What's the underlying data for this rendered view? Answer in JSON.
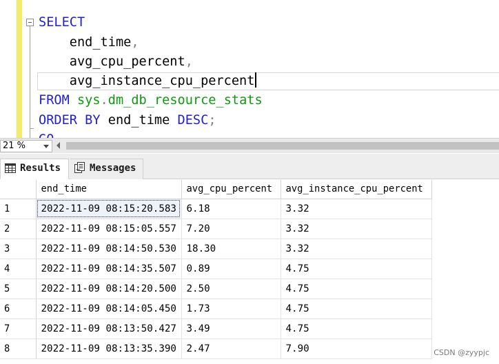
{
  "editor": {
    "lines": {
      "select": "SELECT",
      "col1": "end_time",
      "col2": "avg_cpu_percent",
      "col3": "avg_instance_cpu_percent",
      "from_kw": "FROM",
      "from_schema": "sys",
      "from_obj": "dm_db_resource_stats",
      "order_kw": "ORDER BY",
      "order_col": "end_time",
      "order_dir": "DESC",
      "go_partial": "GO"
    }
  },
  "status": {
    "zoom": "21 %"
  },
  "tabs": {
    "results_label": "Results",
    "messages_label": "Messages"
  },
  "grid": {
    "columns": [
      "end_time",
      "avg_cpu_percent",
      "avg_instance_cpu_percent"
    ],
    "rows": [
      {
        "n": "1",
        "end_time": "2022-11-09 08:15:20.583",
        "avg_cpu_percent": "6.18",
        "avg_instance_cpu_percent": "3.32"
      },
      {
        "n": "2",
        "end_time": "2022-11-09 08:15:05.557",
        "avg_cpu_percent": "7.20",
        "avg_instance_cpu_percent": "3.32"
      },
      {
        "n": "3",
        "end_time": "2022-11-09 08:14:50.530",
        "avg_cpu_percent": "18.30",
        "avg_instance_cpu_percent": "3.32"
      },
      {
        "n": "4",
        "end_time": "2022-11-09 08:14:35.507",
        "avg_cpu_percent": "0.89",
        "avg_instance_cpu_percent": "4.75"
      },
      {
        "n": "5",
        "end_time": "2022-11-09 08:14:20.500",
        "avg_cpu_percent": "2.50",
        "avg_instance_cpu_percent": "4.75"
      },
      {
        "n": "6",
        "end_time": "2022-11-09 08:14:05.450",
        "avg_cpu_percent": "1.73",
        "avg_instance_cpu_percent": "4.75"
      },
      {
        "n": "7",
        "end_time": "2022-11-09 08:13:50.427",
        "avg_cpu_percent": "3.49",
        "avg_instance_cpu_percent": "4.75"
      },
      {
        "n": "8",
        "end_time": "2022-11-09 08:13:35.390",
        "avg_cpu_percent": "2.47",
        "avg_instance_cpu_percent": "7.90"
      }
    ]
  },
  "watermark": "CSDN @zyypjc",
  "colors": {
    "keyword": "#1f1fcf",
    "system_object": "#0e9a0e",
    "punctuation": "#808080",
    "change_bar": "#f3ec6b"
  },
  "icons": {
    "results_tab": "grid-icon",
    "messages_tab": "messages-icon",
    "fold": "collapse-icon"
  }
}
